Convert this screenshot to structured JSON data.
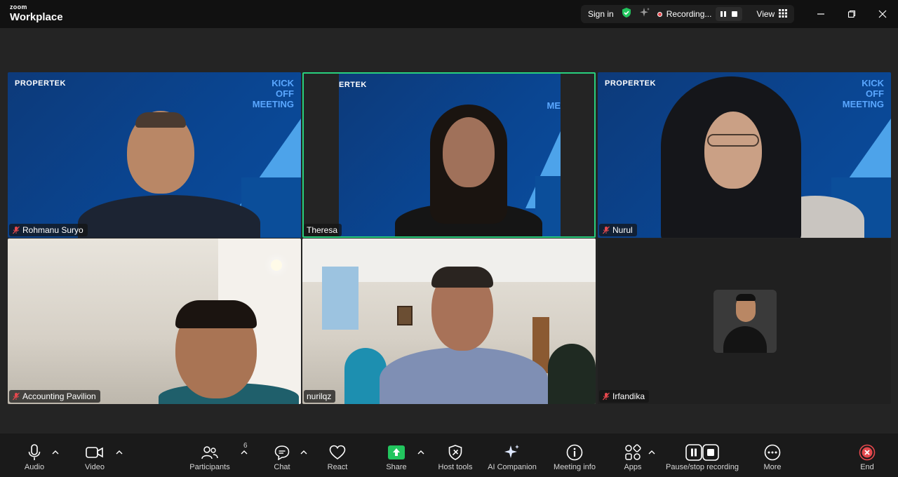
{
  "app": {
    "brand_small": "zoom",
    "brand_large": "Workplace"
  },
  "titlebar": {
    "sign_in": "Sign in",
    "recording": "Recording...",
    "view": "View"
  },
  "tiles": [
    {
      "name": "Rohmanu Suryo",
      "mic": "muted",
      "background": "propertek"
    },
    {
      "name": "Theresa",
      "mic": "active",
      "background": "propertek",
      "active_speaker": true
    },
    {
      "name": "Nurul",
      "mic": "muted",
      "background": "propertek"
    },
    {
      "name": "Accounting Pavilion",
      "mic": "muted",
      "background": "room"
    },
    {
      "name": "nurilqz",
      "mic": "active",
      "background": "room"
    },
    {
      "name": "Irfandika",
      "mic": "muted",
      "background": "avatar"
    }
  ],
  "backdrop": {
    "logo": "PROPERTEK",
    "logo_cropped": "ERTEK",
    "kick_line1": "KICK",
    "kick_line2": "OFF",
    "kick_line3": "MEETING",
    "kick_cropped": "ME"
  },
  "toolbar": {
    "audio": "Audio",
    "video": "Video",
    "participants": "Participants",
    "participants_count": "6",
    "chat": "Chat",
    "react": "React",
    "share": "Share",
    "host_tools": "Host tools",
    "ai_companion": "AI Companion",
    "meeting_info": "Meeting info",
    "apps": "Apps",
    "pause_stop_recording": "Pause/stop recording",
    "more": "More",
    "end": "End"
  },
  "colors": {
    "active_border": "#28d07e",
    "share_green": "#22c55e",
    "end_red": "#e5484d",
    "recording_red": "#e5484d"
  }
}
